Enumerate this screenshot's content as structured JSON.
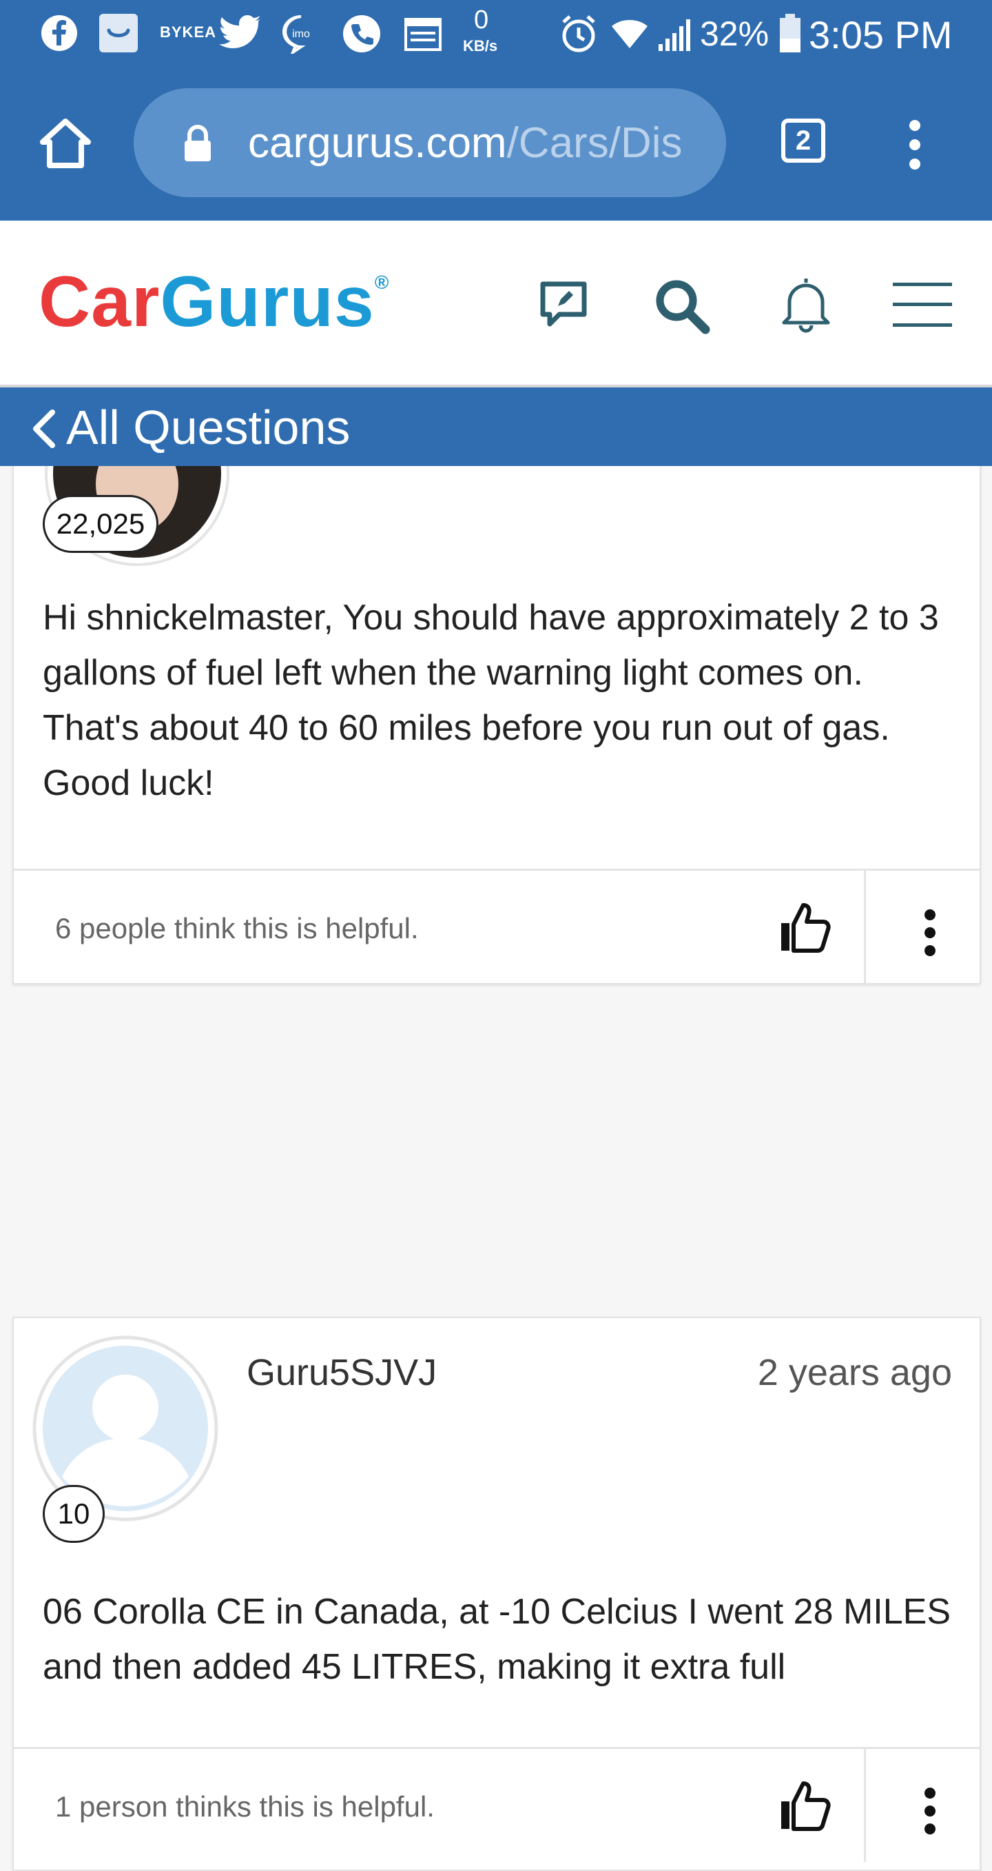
{
  "status_bar": {
    "app_label": "BYKEA",
    "net_speed_value": "0",
    "net_speed_unit": "KB/s",
    "battery": "32%",
    "time": "3:05 PM"
  },
  "browser": {
    "url_domain": "cargurus.com",
    "url_path": "/Cars/Dis",
    "tab_count": "2"
  },
  "site": {
    "logo_part1": "Car",
    "logo_part2": "Gurus",
    "logo_mark": "®"
  },
  "nav": {
    "back_label": "All Questions"
  },
  "answers": [
    {
      "reputation": "22,025",
      "text": "Hi shnickelmaster, You should have approximately 2 to 3 gallons of fuel left when the warning light comes on. That's about 40 to 60 miles before you run out of gas. Good luck!",
      "helpful": "6 people think this is helpful."
    },
    {
      "username": "Guru5SJVJ",
      "time_ago": "2 years ago",
      "reputation": "10",
      "text": "06 Corolla CE in Canada, at -10 Celcius I went 28 MILES and then added 45 LITRES, making it extra full",
      "helpful": "1 person thinks this is helpful."
    }
  ],
  "colors": {
    "brand_blue": "#2f6db0",
    "logo_red": "#e93b3b",
    "logo_blue": "#1b9ad6",
    "icon_teal": "#2e5f6e"
  }
}
